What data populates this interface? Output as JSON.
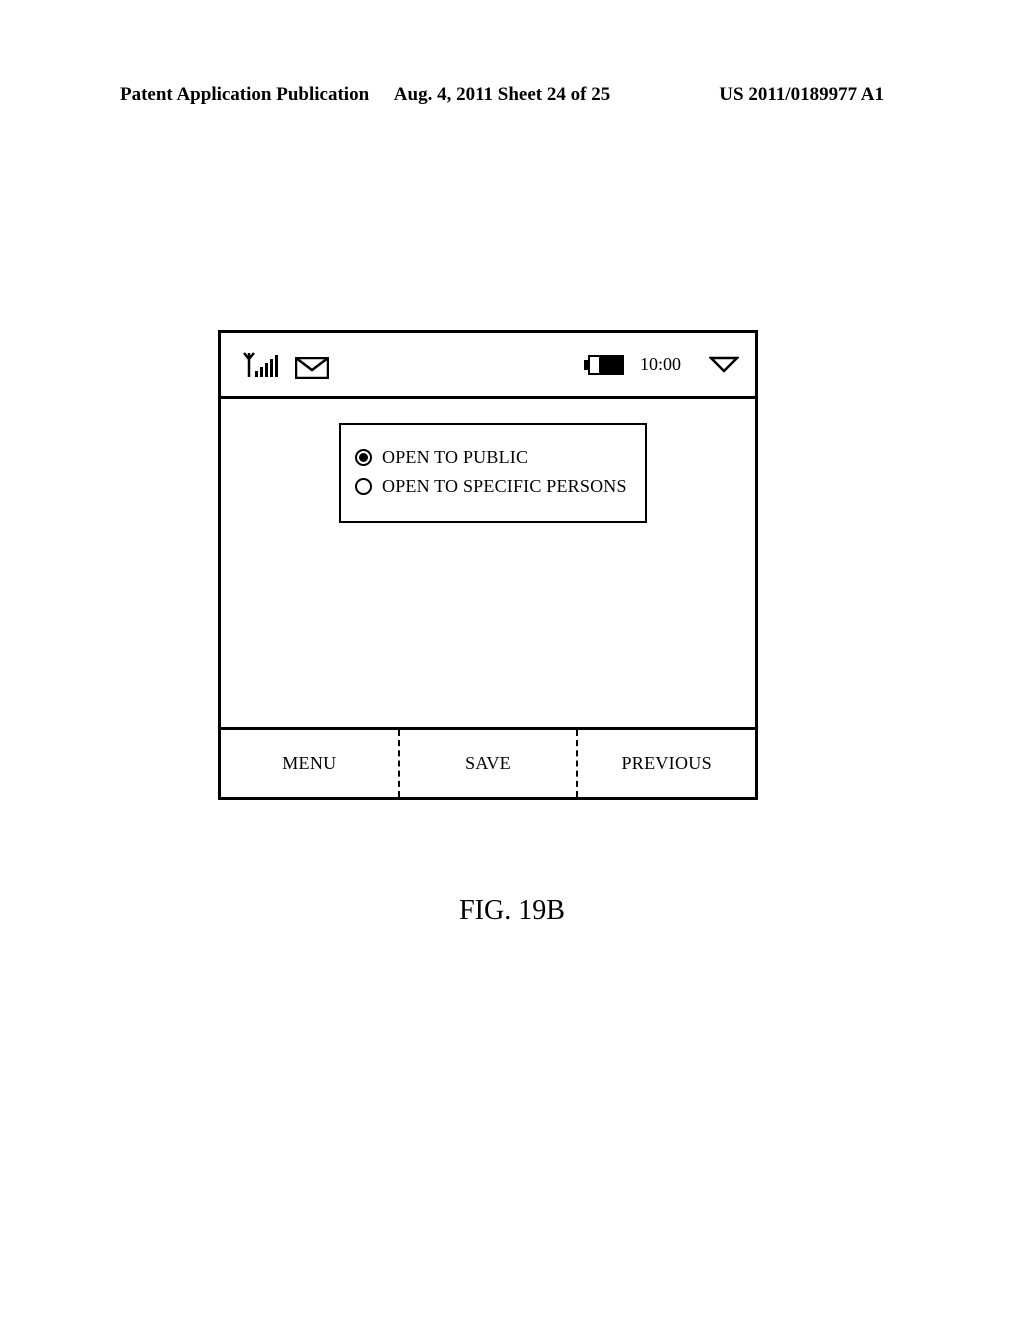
{
  "header": {
    "left": "Patent Application Publication",
    "center": "Aug. 4, 2011  Sheet 24 of 25",
    "right": "US 2011/0189977 A1"
  },
  "statusbar": {
    "time": "10:00"
  },
  "options": {
    "public": "OPEN TO PUBLIC",
    "specific": "OPEN TO SPECIFIC PERSONS"
  },
  "softkeys": {
    "menu": "MENU",
    "save": "SAVE",
    "previous": "PREVIOUS"
  },
  "figure_label": "FIG. 19B"
}
